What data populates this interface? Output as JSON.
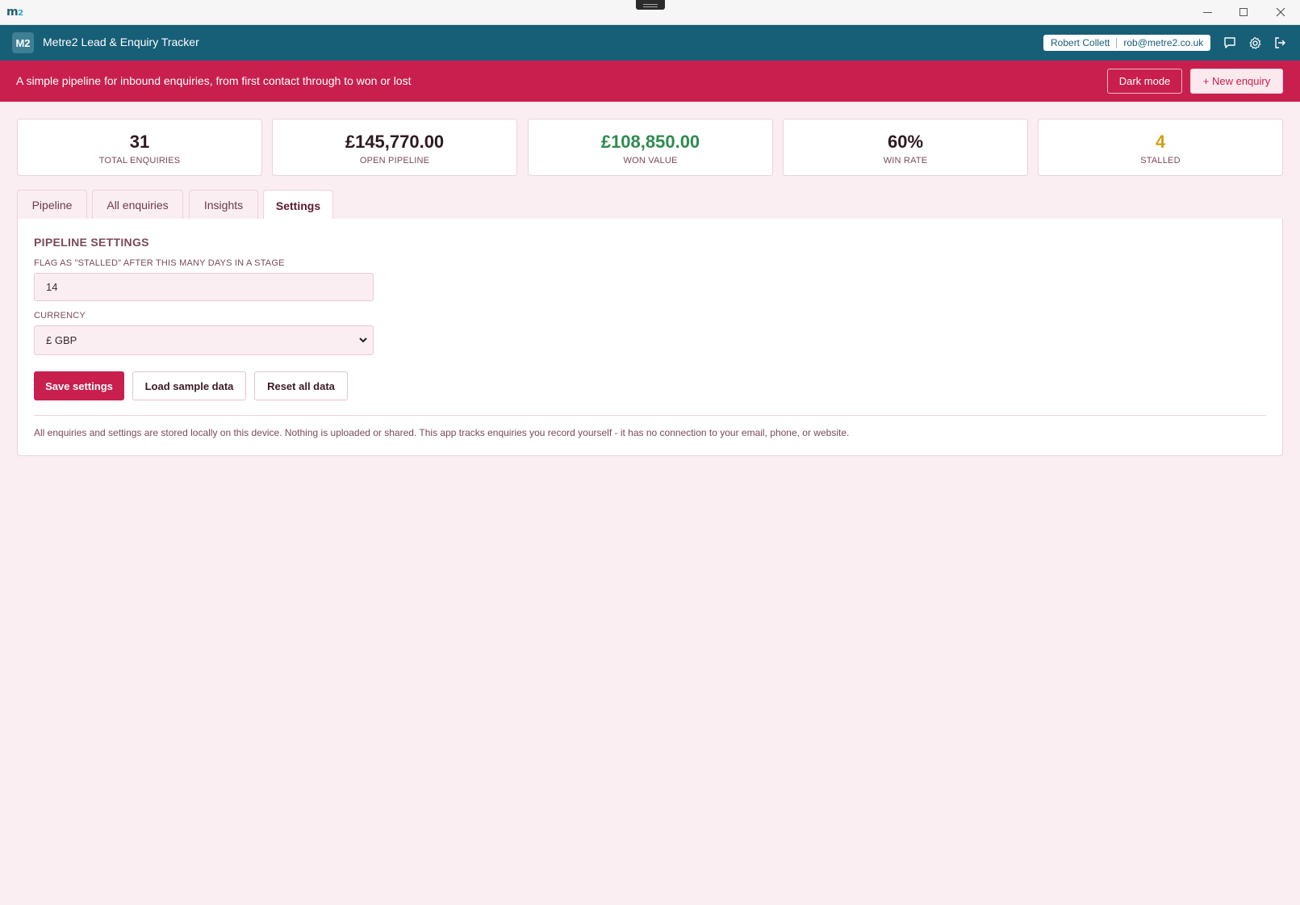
{
  "window": {
    "logo": "m",
    "logo_sup": "2"
  },
  "header": {
    "badge": "M2",
    "title": "Metre2 Lead & Enquiry Tracker",
    "user_name": "Robert Collett",
    "user_email": "rob@metre2.co.uk"
  },
  "banner": {
    "text": "A simple pipeline for inbound enquiries, from first contact through to won or lost",
    "dark_mode_label": "Dark mode",
    "new_enquiry_label": "+ New enquiry"
  },
  "stats": [
    {
      "value": "31",
      "label": "TOTAL ENQUIRIES"
    },
    {
      "value": "£145,770.00",
      "label": "OPEN PIPELINE"
    },
    {
      "value": "£108,850.00",
      "label": "WON VALUE"
    },
    {
      "value": "60%",
      "label": "WIN RATE"
    },
    {
      "value": "4",
      "label": "STALLED"
    }
  ],
  "tabs": [
    {
      "label": "Pipeline"
    },
    {
      "label": "All enquiries"
    },
    {
      "label": "Insights"
    },
    {
      "label": "Settings",
      "active": true
    }
  ],
  "settings": {
    "section_title": "PIPELINE SETTINGS",
    "stalled_label": "FLAG AS \"STALLED\" AFTER THIS MANY DAYS IN A STAGE",
    "stalled_value": "14",
    "currency_label": "CURRENCY",
    "currency_value": "£ GBP",
    "save_label": "Save settings",
    "load_label": "Load sample data",
    "reset_label": "Reset all data",
    "footnote": "All enquiries and settings are stored locally on this device. Nothing is uploaded or shared. This app tracks enquiries you record yourself - it has no connection to your email, phone, or website."
  },
  "colors": {
    "header": "#175e77",
    "banner": "#c81f4e",
    "won": "#2e8b4f",
    "stalled": "#d4a017",
    "background": "#fbeef2"
  },
  "icons": [
    "chat-icon",
    "gear-icon",
    "logout-icon",
    "chevron-down-icon",
    "minimize-icon",
    "maximize-icon",
    "close-icon"
  ]
}
